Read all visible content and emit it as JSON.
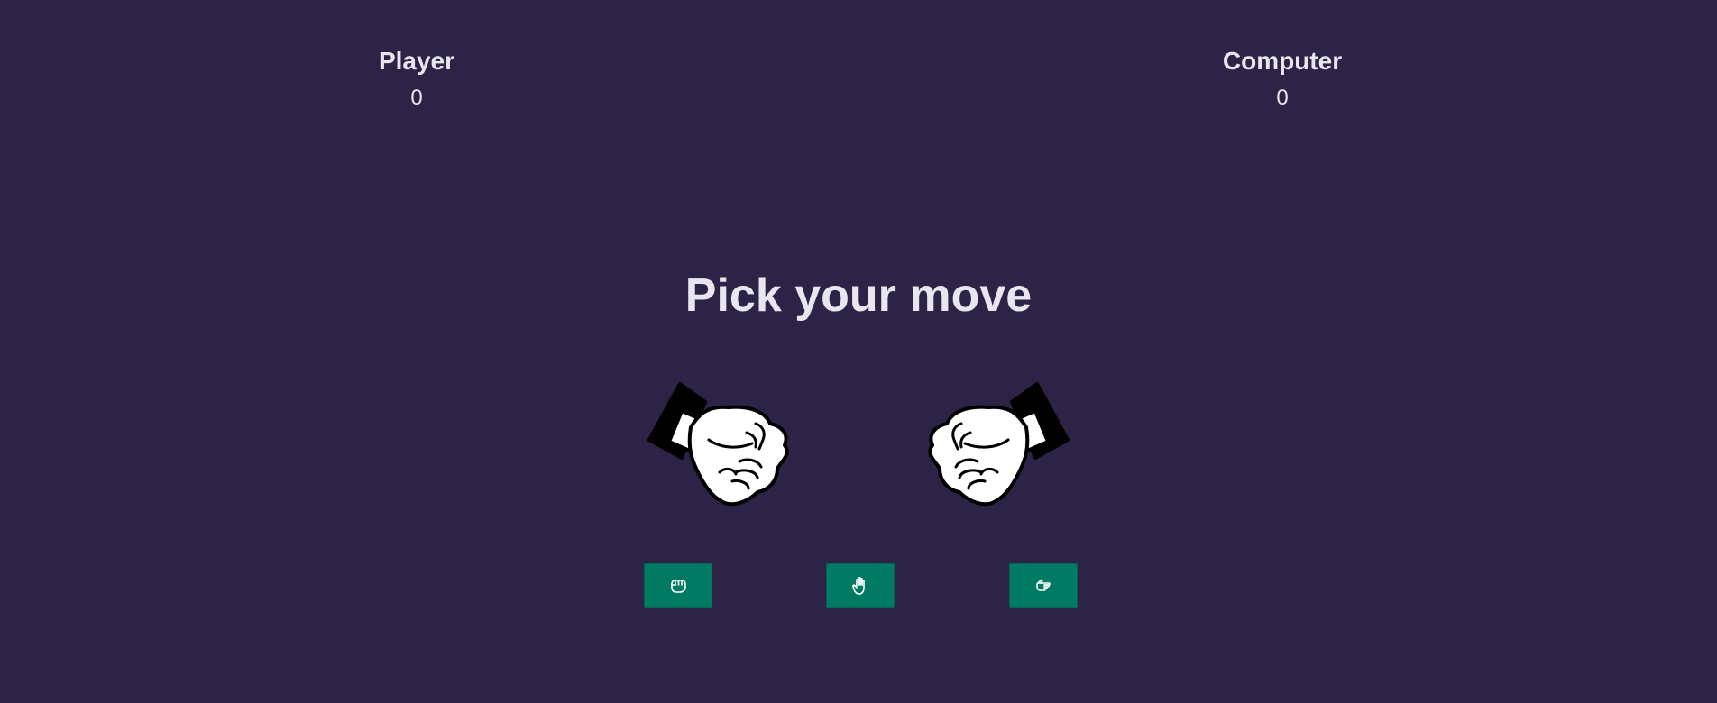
{
  "scoreboard": {
    "player": {
      "label": "Player",
      "score": "0"
    },
    "computer": {
      "label": "Computer",
      "score": "0"
    }
  },
  "prompt": "Pick your move",
  "arena": {
    "player_hand": "fist-icon",
    "computer_hand": "fist-icon"
  },
  "moves": [
    {
      "name": "rock",
      "icon": "hand-rock-icon"
    },
    {
      "name": "paper",
      "icon": "hand-paper-icon"
    },
    {
      "name": "scissors",
      "icon": "hand-scissors-icon"
    }
  ],
  "colors": {
    "background": "#2c2346",
    "text": "#e8e6ee",
    "button": "#007a63"
  }
}
